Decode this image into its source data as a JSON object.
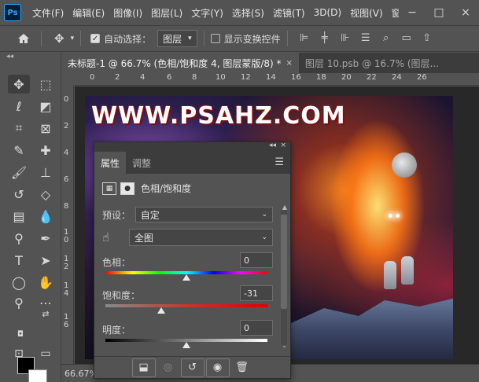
{
  "menubar": {
    "logo": "Ps",
    "items": [
      "文件(F)",
      "编辑(E)",
      "图像(I)",
      "图层(L)",
      "文字(Y)",
      "选择(S)",
      "滤镜(T)",
      "3D(D)",
      "视图(V)",
      "窗口"
    ],
    "controls": [
      "−",
      "□",
      "×"
    ]
  },
  "options": {
    "auto_select_label": "自动选择：",
    "auto_select_checked": true,
    "auto_select_value": "图层",
    "show_transform_label": "显示变换控件",
    "show_transform_checked": false
  },
  "tabs": [
    {
      "label": "未标题-1 @ 66.7% (色相/饱和度 4, 图层蒙版/8) *",
      "active": true
    },
    {
      "label": "图层 10.psb @ 16.7% (图层...",
      "active": false
    }
  ],
  "ruler": {
    "h": [
      "0",
      "2",
      "4",
      "6",
      "8",
      "10",
      "12",
      "14",
      "16",
      "18",
      "20",
      "22",
      "24",
      "26"
    ],
    "v": [
      "0",
      "2",
      "4",
      "6",
      "8",
      "1\n0",
      "1\n2",
      "1\n4",
      "1\n6"
    ]
  },
  "artwork": {
    "watermark": "WWW.PSAHZ.COM"
  },
  "status": {
    "zoom": "66.67%"
  },
  "properties": {
    "tab_active": "属性",
    "tab_inactive": "调整",
    "adjustment_title": "色相/饱和度",
    "preset_label": "预设：",
    "preset_value": "自定",
    "channel_value": "全图",
    "hue_label": "色相：",
    "hue_value": "0",
    "hue_level": 0.5,
    "saturation_label": "饱和度：",
    "saturation_value": "-31",
    "saturation_level": 0.345,
    "lightness_label": "明度：",
    "lightness_value": "0",
    "lightness_level": 0.5
  }
}
